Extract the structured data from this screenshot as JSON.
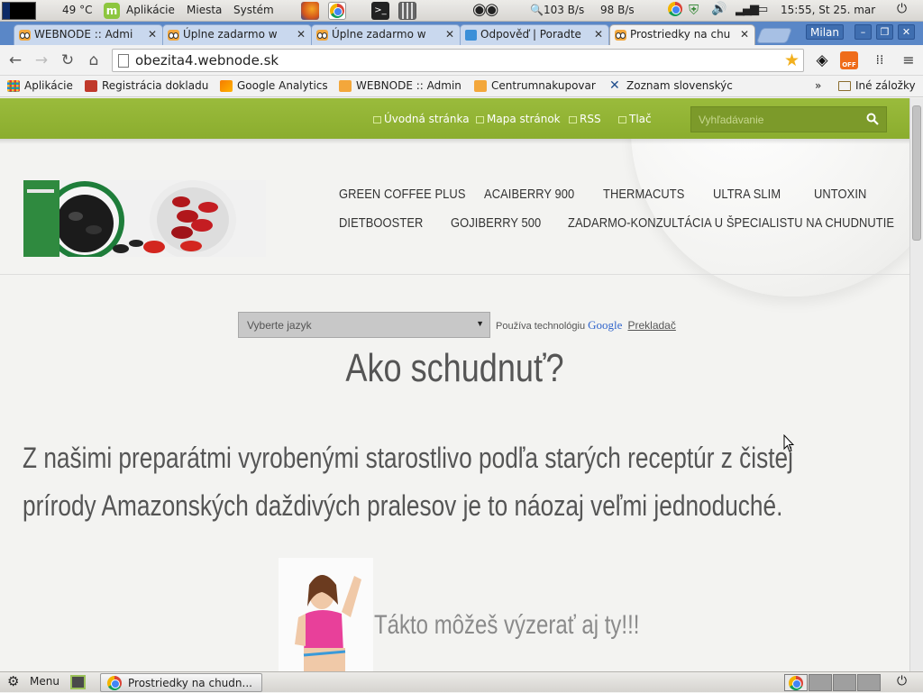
{
  "system_panel": {
    "temperature": "49 °C",
    "menu_applications": "Aplikácie",
    "menu_places": "Miesta",
    "menu_system": "Systém",
    "net_down": "103 B/s",
    "net_up": "98 B/s",
    "clock": "15:55, St 25. mar"
  },
  "browser": {
    "tabs": [
      {
        "label": "WEBNODE :: Admi",
        "icon": "webnode-owl-icon"
      },
      {
        "label": "Úplne zadarmo w",
        "icon": "webnode-owl-icon"
      },
      {
        "label": "Úplne zadarmo w",
        "icon": "webnode-owl-icon"
      },
      {
        "label": "Odpověď | Poradte",
        "icon": "question-icon"
      },
      {
        "label": "Prostriedky na chu",
        "icon": "webnode-owl-icon",
        "active": true
      }
    ],
    "user": "Milan",
    "url": "obezita4.webnode.sk",
    "bookmarks": [
      {
        "label": "Aplikácie",
        "icon": "apps-grid-icon"
      },
      {
        "label": "Registrácia dokladu",
        "icon": "receipt-icon"
      },
      {
        "label": "Google Analytics",
        "icon": "analytics-icon"
      },
      {
        "label": "WEBNODE :: Admin",
        "icon": "webnode-owl-icon"
      },
      {
        "label": "Centrumnakupovar",
        "icon": "webnode-owl-icon"
      },
      {
        "label": "Zoznam slovenskýc",
        "icon": "x-logo-icon"
      }
    ],
    "bookmarks_overflow": "»",
    "other_bookmarks": "Iné záložky"
  },
  "site": {
    "top_nav": [
      "Úvodná stránka",
      "Mapa stránok",
      "RSS",
      "Tlač"
    ],
    "search_placeholder": "Vyhľadávanie",
    "menu_row1": [
      "GREEN COFFEE PLUS",
      "ACAIBERRY 900",
      "THERMACUTS",
      "ULTRA SLIM",
      "UNTOXIN"
    ],
    "menu_row2": [
      "DIETBOOSTER",
      "GOJIBERRY 500",
      "ZADARMO-KONZULTÁCIA U ŠPECIALISTU NA CHUDNUTIE"
    ],
    "language_select": "Vyberte jazyk",
    "powered_by": "Používa technológiu",
    "google": "Google",
    "translate": "Prekladač",
    "heading": "Ako schudnuť?",
    "lead_line1": "Z našimi preparátmi vyrobenými starostlivo podľa starých receptúr z čistej",
    "lead_line2": "prírody Amazonských daždivých pralesov  je to náozaj veľmi  jednoduché.",
    "tagline": "Tákto môžeš výzerať aj ty!!!"
  },
  "taskbar": {
    "menu": "Menu",
    "window_button": "Prostriedky na chudn..."
  },
  "colors": {
    "site_green": "#9abb3c",
    "tab_bar_blue": "#5a87c7"
  }
}
